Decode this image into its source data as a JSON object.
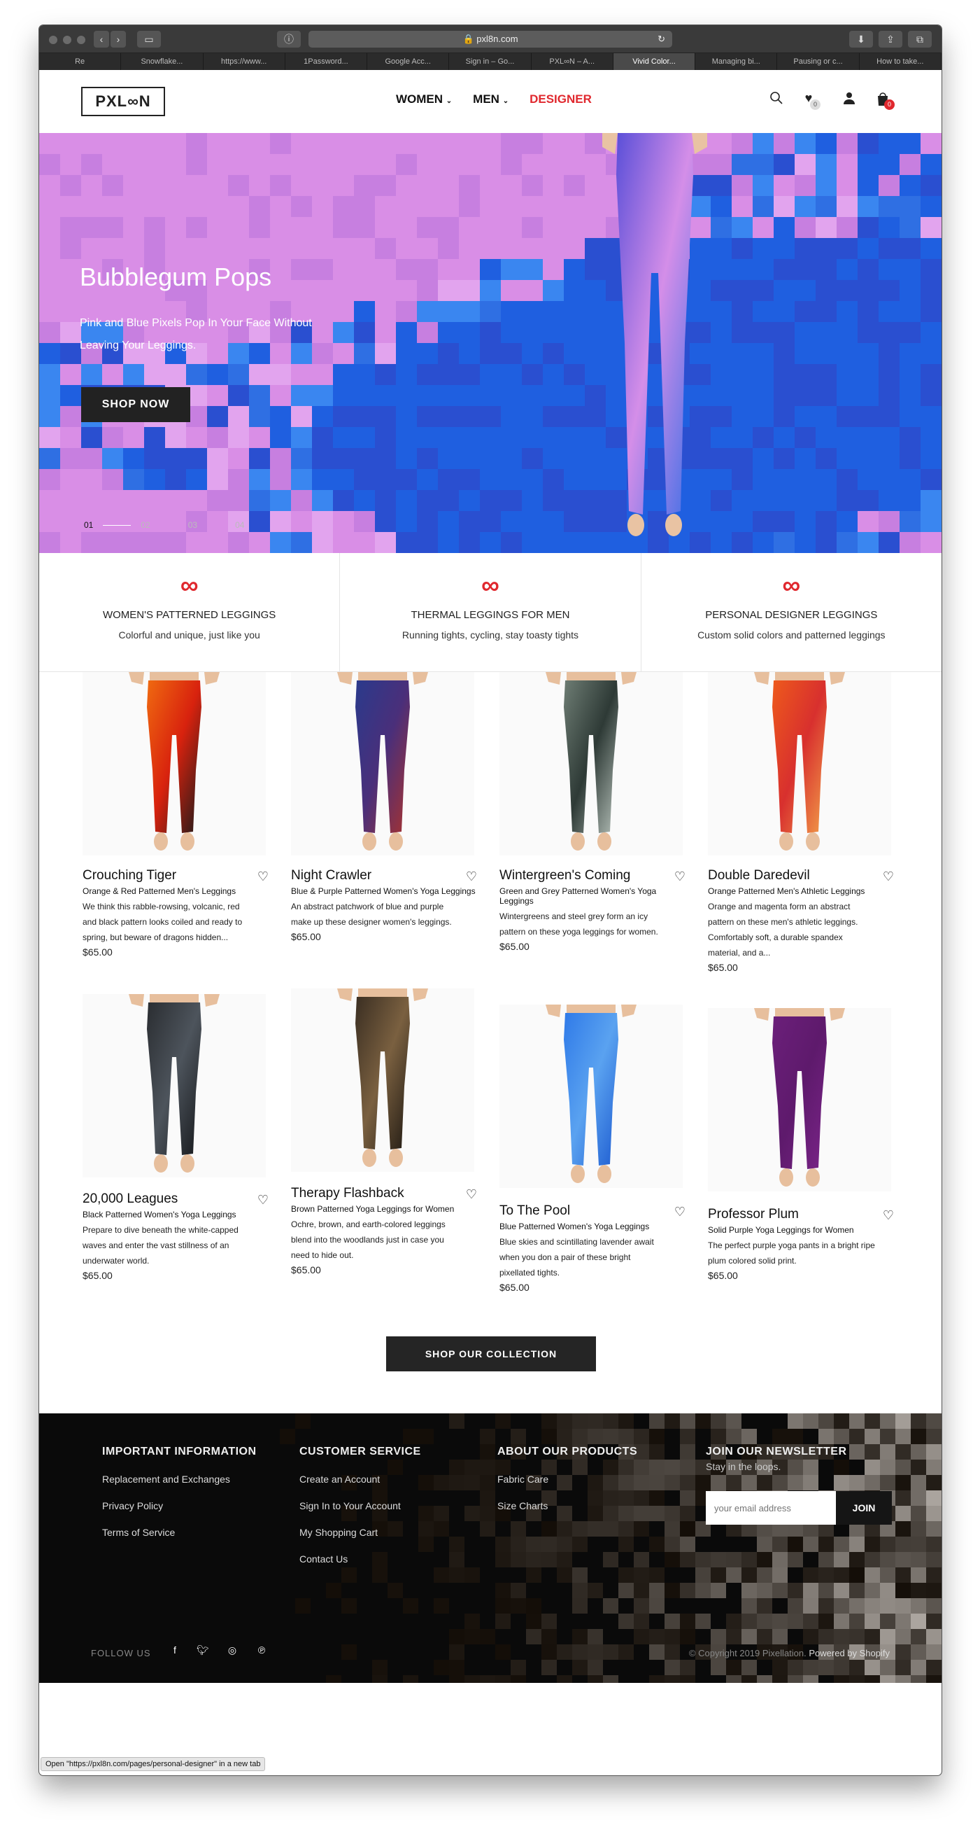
{
  "browser": {
    "url": "pxl8n.com",
    "tabs": [
      "Re",
      "Snowflake...",
      "https://www...",
      "1Password...",
      "Google Acc...",
      "Sign in – Go...",
      "PXL∞N – A...",
      "Vivid Color...",
      "Managing bi...",
      "Pausing or c...",
      "How to take..."
    ],
    "active_tab": 7,
    "status": "Open \"https://pxl8n.com/pages/personal-designer\" in a new tab"
  },
  "header": {
    "logo": "PXL∞N",
    "nav": [
      "WOMEN",
      "MEN",
      "DESIGNER"
    ],
    "wishlist_count": "0",
    "cart_count": "0"
  },
  "hero": {
    "title": "Bubblegum Pops",
    "subtitle": "Pink and Blue Pixels Pop In Your Face Without Leaving Your Leggings.",
    "button": "SHOP NOW",
    "slides": [
      "01",
      "02",
      "03",
      "04"
    ]
  },
  "categories": [
    {
      "title": "WOMEN'S PATTERNED LEGGINGS",
      "subtitle": "Colorful and unique, just like you",
      "icon": "infinity-icon"
    },
    {
      "title": "THERMAL LEGGINGS FOR MEN",
      "subtitle": "Running tights, cycling, stay toasty tights",
      "icon": "infinity-icon"
    },
    {
      "title": "PERSONAL DESIGNER LEGGINGS",
      "subtitle": "Custom solid colors and patterned leggings",
      "icon": "infinity-icon"
    }
  ],
  "products": [
    {
      "name": "Crouching Tiger",
      "type": "Orange & Red Patterned Men's Leggings",
      "desc": "We think this rabble-rowsing, volcanic, red and black pattern looks coiled and ready to spring, but beware of dragons hidden...",
      "price": "$65.00",
      "colors": [
        "#f06a10",
        "#d8220e",
        "#1a1a1a"
      ]
    },
    {
      "name": "Night Crawler",
      "type": "Blue & Purple Patterned Women's Yoga Leggings",
      "desc": "An abstract patchwork of blue and purple make up these designer women's leggings.",
      "price": "$65.00",
      "colors": [
        "#2a3a8c",
        "#4a2f7a",
        "#a8322e"
      ]
    },
    {
      "name": "Wintergreen's Coming",
      "type": "Green and Grey Patterned Women's Yoga Leggings",
      "desc": "Wintergreens and steel grey form an icy pattern on these yoga leggings for women.",
      "price": "$65.00",
      "colors": [
        "#6e7d74",
        "#2e3a36",
        "#b7c2bb"
      ]
    },
    {
      "name": "Double Daredevil",
      "type": "Orange Patterned Men's Athletic Leggings",
      "desc": "Orange and magenta form an abstract pattern on these men's athletic leggings. Comfortably soft, a durable spandex material, and a...",
      "price": "$65.00",
      "colors": [
        "#ee5a1c",
        "#d8302e",
        "#f2a04a"
      ]
    },
    {
      "name": "20,000 Leagues",
      "type": "Black Patterned Women's Yoga Leggings",
      "desc": "Prepare to dive beneath the white-capped waves and enter the vast stillness of an underwater world.",
      "price": "$65.00",
      "colors": [
        "#2a2d31",
        "#4d545c",
        "#15171a"
      ]
    },
    {
      "name": "Therapy Flashback",
      "type": "Brown Patterned Yoga Leggings for Women",
      "desc": "Ochre, brown, and earth-colored leggings blend into the woodlands just in case you need to hide out.",
      "price": "$65.00",
      "colors": [
        "#3a2e22",
        "#7a6040",
        "#1e1812"
      ]
    },
    {
      "name": "To The Pool",
      "type": "Blue Patterned Women's Yoga Leggings",
      "desc": "Blue skies and scintillating lavender await when you don a pair of these bright pixellated tights.",
      "price": "$65.00",
      "colors": [
        "#2f7ae8",
        "#5aa2f0",
        "#1d5bd0"
      ]
    },
    {
      "name": "Professor Plum",
      "type": "Solid Purple Yoga Leggings for Women",
      "desc": "The perfect purple yoga pants in a bright ripe plum colored solid print.",
      "price": "$65.00",
      "colors": [
        "#6b1f7a",
        "#5e1a6c",
        "#7a2488"
      ]
    }
  ],
  "shop_button": "SHOP OUR COLLECTION",
  "footer": {
    "columns": [
      {
        "title": "IMPORTANT INFORMATION",
        "links": [
          "Replacement and Exchanges",
          "Privacy Policy",
          "Terms of Service"
        ]
      },
      {
        "title": "CUSTOMER SERVICE",
        "links": [
          "Create an Account",
          "Sign In to Your Account",
          "My Shopping Cart",
          "Contact Us"
        ]
      },
      {
        "title": "ABOUT OUR PRODUCTS",
        "links": [
          "Fabric Care",
          "Size Charts"
        ]
      }
    ],
    "newsletter": {
      "title": "JOIN OUR NEWSLETTER",
      "subtitle": "Stay in the loops.",
      "placeholder": "your email address",
      "button": "JOIN"
    },
    "follow": "FOLLOW US",
    "copyright": "© Copyright 2019 Pixellation.",
    "powered": "Powered by Shopify"
  },
  "colors": {
    "accent": "#e0282e",
    "dark": "#222222",
    "hero_blue": "#2f6fe3",
    "hero_pink": "#d98ee6"
  }
}
